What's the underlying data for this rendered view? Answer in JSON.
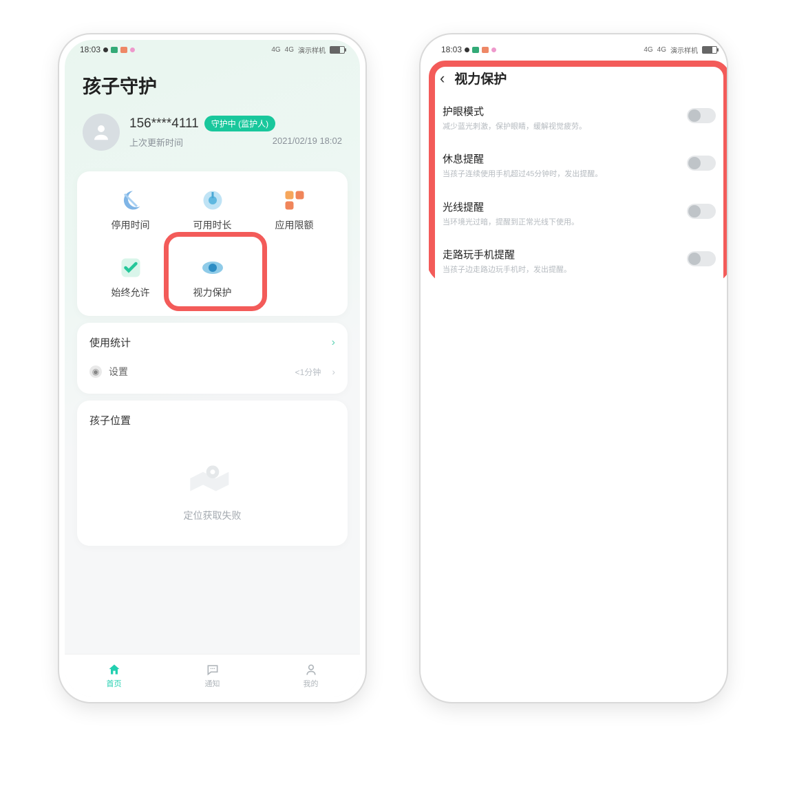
{
  "status": {
    "time": "18:03",
    "carrier": "演示样机",
    "net": "4G",
    "battery": "77"
  },
  "p1": {
    "title": "孩子守护",
    "phone": "156****4111",
    "badge": "守护中 (监护人)",
    "lastUpdateLabel": "上次更新时间",
    "lastUpdateTime": "2021/02/19 18:02",
    "gridItems": [
      {
        "label": "停用时间"
      },
      {
        "label": "可用时长"
      },
      {
        "label": "应用限额"
      },
      {
        "label": "始终允许"
      },
      {
        "label": "视力保护"
      }
    ],
    "stats": {
      "title": "使用统计",
      "setting": "设置",
      "time": "<1分钟"
    },
    "location": {
      "title": "孩子位置",
      "fail": "定位获取失败"
    },
    "tabs": [
      {
        "label": "首页"
      },
      {
        "label": "通知"
      },
      {
        "label": "我的"
      }
    ]
  },
  "p2": {
    "title": "视力保护",
    "items": [
      {
        "t1": "护眼模式",
        "t2": "减少蓝光刺激，保护眼睛，缓解视觉疲劳。"
      },
      {
        "t1": "休息提醒",
        "t2": "当孩子连续使用手机超过45分钟时，发出提醒。"
      },
      {
        "t1": "光线提醒",
        "t2": "当环境光过暗，提醒到正常光线下使用。"
      },
      {
        "t1": "走路玩手机提醒",
        "t2": "当孩子边走路边玩手机时，发出提醒。"
      }
    ]
  }
}
